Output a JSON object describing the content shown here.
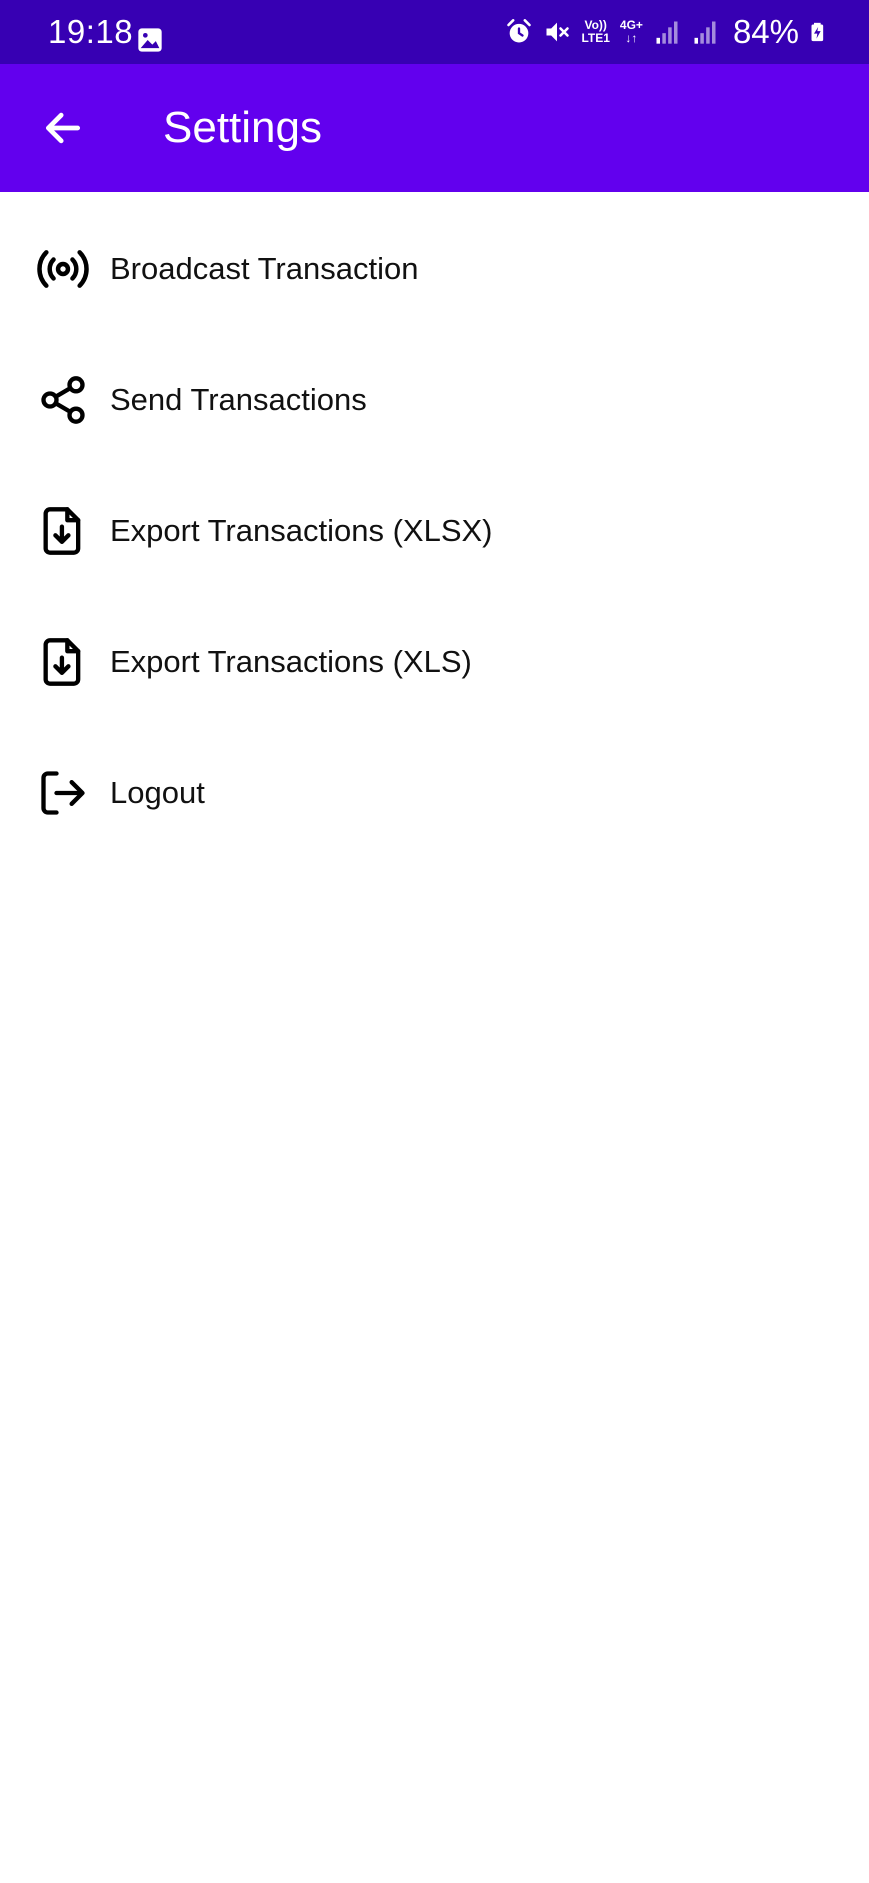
{
  "status_bar": {
    "time": "19:18",
    "network_top": "Vo))",
    "network_bottom": "LTE1",
    "network_type": "4G+",
    "battery": "84%",
    "icons": [
      "gallery-icon",
      "alarm-icon",
      "mute-icon",
      "volte-icon",
      "data-arrows-icon",
      "signal-icon",
      "signal-icon",
      "battery-charging-icon"
    ]
  },
  "app_bar": {
    "title": "Settings",
    "back_icon": "arrow-left-icon",
    "background": "#6200ee",
    "status_background": "#3700b3"
  },
  "menu": {
    "items": [
      {
        "label": "Broadcast Transaction",
        "icon": "broadcast-icon"
      },
      {
        "label": "Send Transactions",
        "icon": "share-icon"
      },
      {
        "label": "Export Transactions (XLSX)",
        "icon": "file-download-icon"
      },
      {
        "label": "Export Transactions (XLS)",
        "icon": "file-download-icon"
      },
      {
        "label": "Logout",
        "icon": "logout-icon"
      }
    ]
  }
}
